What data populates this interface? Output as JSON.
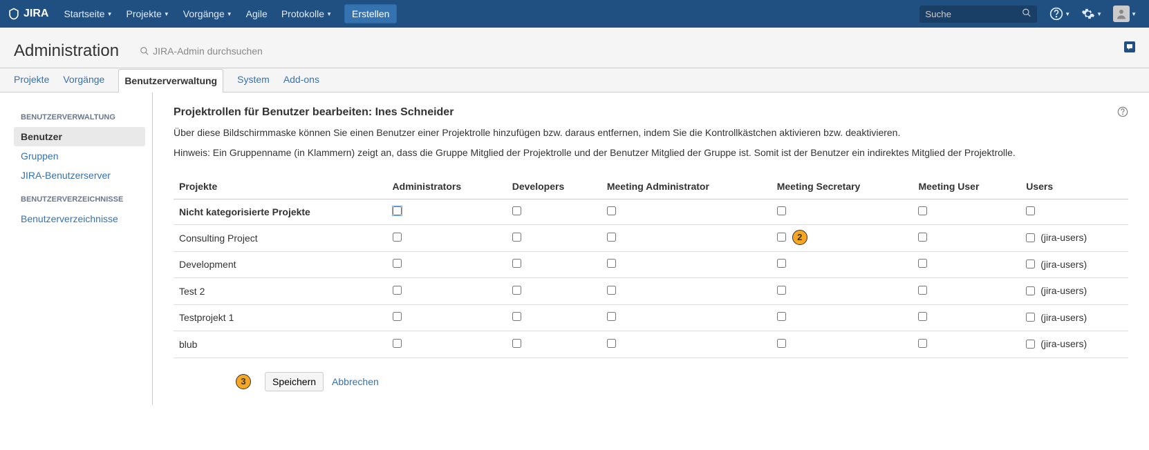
{
  "nav": {
    "logo": "JIRA",
    "items": [
      "Startseite",
      "Projekte",
      "Vorgänge",
      "Agile",
      "Protokolle"
    ],
    "create": "Erstellen",
    "search_placeholder": "Suche"
  },
  "header": {
    "title": "Administration",
    "search_placeholder": "JIRA-Admin durchsuchen"
  },
  "tabs": [
    {
      "label": "Projekte",
      "active": false
    },
    {
      "label": "Vorgänge",
      "active": false
    },
    {
      "label": "Benutzerverwaltung",
      "active": true
    },
    {
      "label": "System",
      "active": false
    },
    {
      "label": "Add-ons",
      "active": false
    }
  ],
  "sidebar": {
    "section1_title": "BENUTZERVERWALTUNG",
    "section1_items": [
      {
        "label": "Benutzer",
        "active": true
      },
      {
        "label": "Gruppen",
        "active": false
      },
      {
        "label": "JIRA-Benutzerserver",
        "active": false
      }
    ],
    "section2_title": "BENUTZERVERZEICHNISSE",
    "section2_items": [
      {
        "label": "Benutzerverzeichnisse",
        "active": false
      }
    ]
  },
  "page": {
    "title": "Projektrollen für Benutzer bearbeiten: Ines Schneider",
    "desc1": "Über diese Bildschirmmaske können Sie einen Benutzer einer Projektrolle hinzufügen bzw. daraus entfernen, indem Sie die Kontrollkästchen aktivieren bzw. deaktivieren.",
    "desc2": "Hinweis: Ein Gruppenname (in Klammern) zeigt an, dass die Gruppe Mitglied der Projektrolle und der Benutzer Mitglied der Gruppe ist. Somit ist der Benutzer ein indirektes Mitglied der Projektrolle."
  },
  "table": {
    "columns": [
      "Projekte",
      "Administrators",
      "Developers",
      "Meeting Administrator",
      "Meeting Secretary",
      "Meeting User",
      "Users"
    ],
    "category_row": "Nicht kategorisierte Projekte",
    "rows": [
      {
        "name": "Consulting Project",
        "users_extra": "(jira-users)"
      },
      {
        "name": "Development",
        "users_extra": "(jira-users)"
      },
      {
        "name": "Test 2",
        "users_extra": "(jira-users)"
      },
      {
        "name": "Testprojekt 1",
        "users_extra": "(jira-users)"
      },
      {
        "name": "blub",
        "users_extra": "(jira-users)"
      }
    ]
  },
  "buttons": {
    "save": "Speichern",
    "cancel": "Abbrechen"
  },
  "annotations": {
    "b2": "2",
    "b3": "3"
  }
}
